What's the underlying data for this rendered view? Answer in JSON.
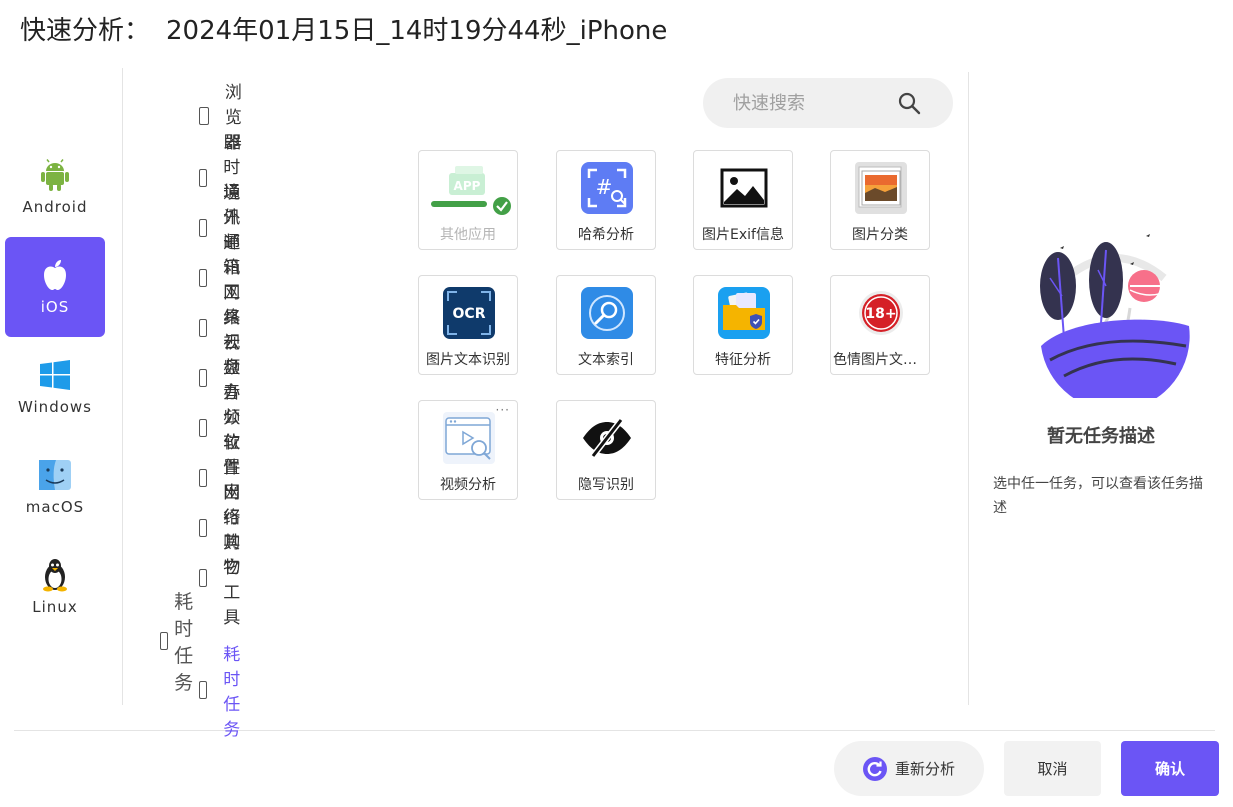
{
  "title": {
    "prefix": "快速分析：",
    "name": "2024年01月15日_14时19分44秒_iPhone"
  },
  "os_tabs": [
    {
      "label": "Android",
      "icon": "android-icon",
      "active": false
    },
    {
      "label": "iOS",
      "icon": "apple-icon",
      "active": true
    },
    {
      "label": "Windows",
      "icon": "windows-icon",
      "active": false
    },
    {
      "label": "macOS",
      "icon": "finder-icon",
      "active": false
    },
    {
      "label": "Linux",
      "icon": "penguin-icon",
      "active": false
    }
  ],
  "categories": [
    "浏览器",
    "即时通讯",
    "境外通讯",
    "邮箱工具",
    "网络云盘",
    "视频音频",
    "办公软件",
    "位置出行",
    "网络购物",
    "其它工具"
  ],
  "group": {
    "label": "耗时任务",
    "items": [
      "耗时任务"
    ]
  },
  "search": {
    "placeholder": "快速搜索"
  },
  "tiles": [
    {
      "label": "其他应用",
      "icon": "app-check-icon",
      "disabled": true
    },
    {
      "label": "哈希分析",
      "icon": "hash-search-icon"
    },
    {
      "label": "图片Exif信息",
      "icon": "image-icon"
    },
    {
      "label": "图片分类",
      "icon": "photo-stack-icon"
    },
    {
      "label": "图片文本识别",
      "icon": "ocr-icon",
      "badge": "OCR"
    },
    {
      "label": "文本索引",
      "icon": "disk-search-icon"
    },
    {
      "label": "特征分析",
      "icon": "folder-shield-icon"
    },
    {
      "label": "色情图片文字识别",
      "icon": "adult-18-icon",
      "badge": "18+"
    },
    {
      "label": "视频分析",
      "icon": "video-search-icon",
      "more": "···"
    },
    {
      "label": "隐写识别",
      "icon": "eye-slash-icon"
    }
  ],
  "description": {
    "title": "暂无任务描述",
    "text": "选中任一任务，可以查看该任务描述"
  },
  "buttons": {
    "reanalyze": "重新分析",
    "cancel": "取消",
    "confirm": "确认"
  },
  "colors": {
    "accent": "#6b55f5",
    "success": "#43a047"
  }
}
